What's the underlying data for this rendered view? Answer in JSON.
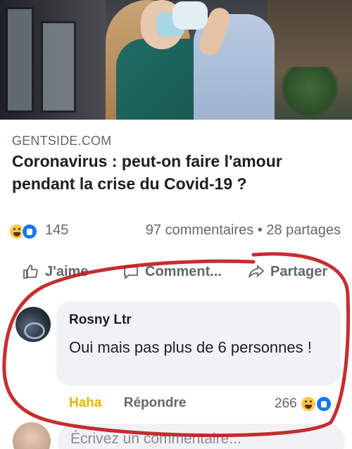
{
  "post": {
    "source": "GENTSIDE.COM",
    "title": "Coronavirus : peut-on faire l'amour pendant la crise du Covid-19 ?"
  },
  "stats": {
    "reactions_count": "145",
    "comments": "97 commentaires",
    "separator": "•",
    "shares": "28 partages"
  },
  "actions": {
    "like": "J'aime",
    "comment": "Comment...",
    "share": "Partager"
  },
  "comment": {
    "author": "Rosny Ltr",
    "text": "Oui mais pas plus de 6 personnes !",
    "haha_label": "Haha",
    "reply_label": "Répondre",
    "reactions_count": "266"
  },
  "composer": {
    "placeholder": "Écrivez un commentaire..."
  },
  "colors": {
    "annotation_circle": "#c0171a",
    "facebook_blue": "#1877f2",
    "haha_yellow": "#e8b600"
  }
}
